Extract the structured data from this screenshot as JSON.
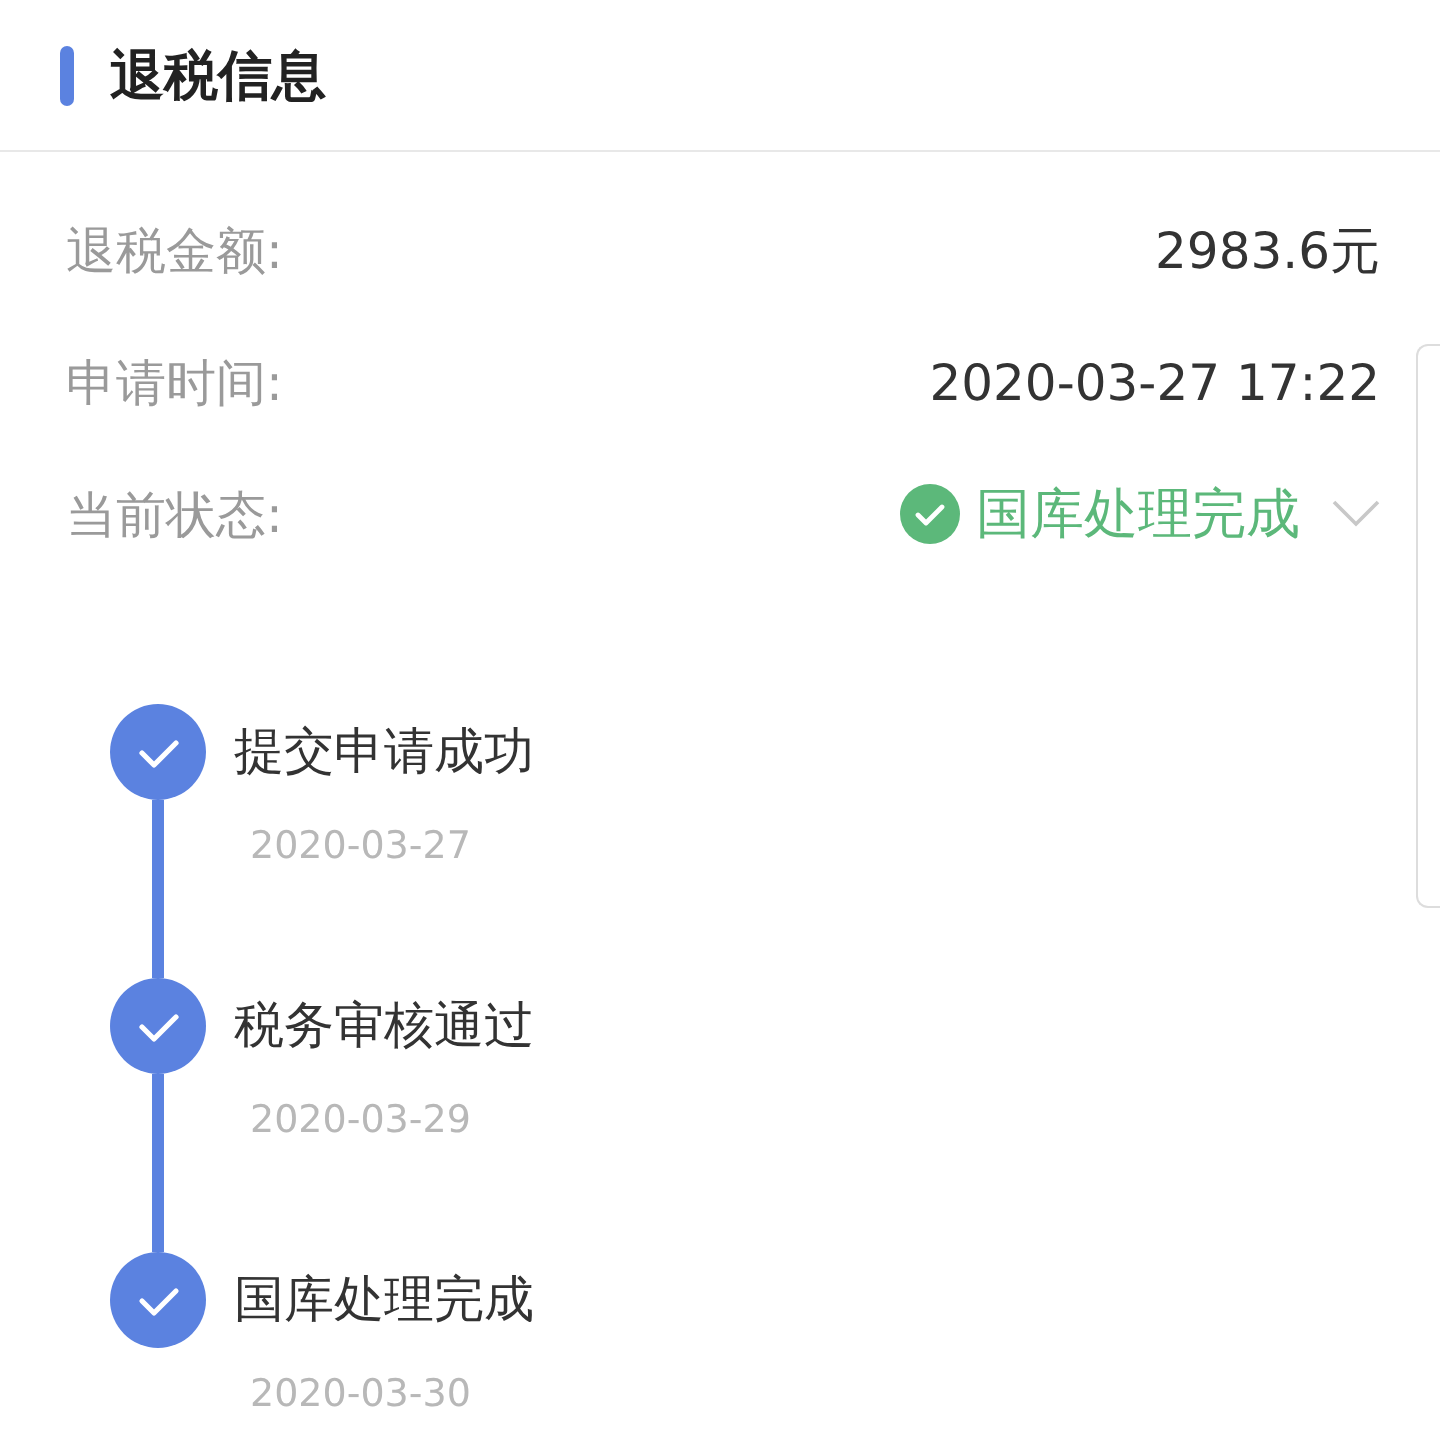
{
  "section": {
    "title": "退税信息"
  },
  "fields": [
    {
      "label": "退税金额:",
      "value": "2983.6元"
    },
    {
      "label": "申请时间:",
      "value": "2020-03-27 17:22"
    }
  ],
  "status": {
    "label": "当前状态:",
    "value": "国库处理完成",
    "kind": "success",
    "expanded": false
  },
  "steps": [
    {
      "title": "提交申请成功",
      "date": "2020-03-27",
      "done": true
    },
    {
      "title": "税务审核通过",
      "date": "2020-03-29",
      "done": true
    },
    {
      "title": "国库处理完成",
      "date": "2020-03-30",
      "done": true
    }
  ]
}
